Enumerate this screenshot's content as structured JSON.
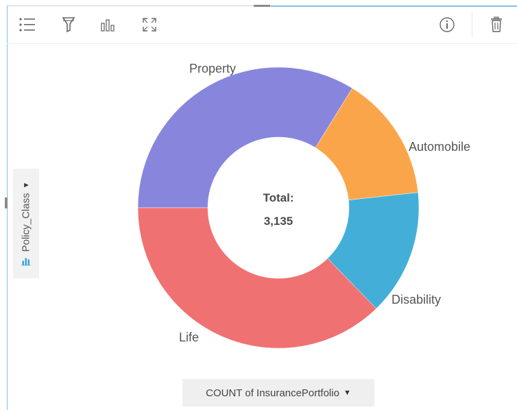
{
  "toolbar": {
    "icons": [
      "legend-icon",
      "filter-icon",
      "visualization-type-icon",
      "maximize-icon",
      "info-icon",
      "delete-icon"
    ]
  },
  "axis": {
    "y_field": "Policy_Class",
    "x_field": "COUNT of InsurancePortfolio"
  },
  "center": {
    "label": "Total:",
    "value": "3,135"
  },
  "colors": {
    "Property": "#8886dc",
    "Automobile": "#fba54b",
    "Disability": "#43afd8",
    "Life": "#f07172",
    "accent": "#7cc0e6"
  },
  "chart_data": {
    "type": "pie",
    "donut": true,
    "categories": [
      "Property",
      "Automobile",
      "Disability",
      "Life"
    ],
    "values": [
      1060,
      453,
      454,
      1168
    ],
    "total": 3135
  }
}
